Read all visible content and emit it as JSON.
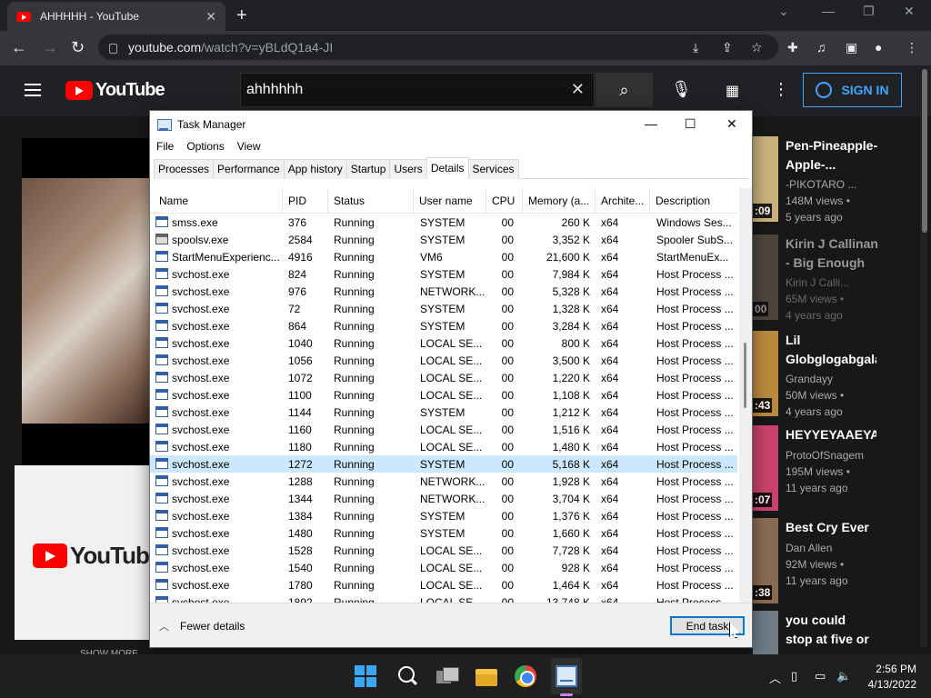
{
  "browser": {
    "tab_title": "AHHHHH - YouTube",
    "url_host": "youtube.com",
    "url_path": "/watch?v=yBLdQ1a4-JI"
  },
  "youtube": {
    "logo_text": "YouTube",
    "search_value": "ahhhhhh",
    "signin_label": "SIGN IN",
    "card_logo_text": "YouTube",
    "show_more": "SHOW MORE",
    "recommendations": [
      {
        "title": "Pen-Pineapple-Apple-...",
        "channel": "-PIKOTARO ...",
        "views": "148M views •",
        "age": "5 years ago",
        "duration": ":09"
      },
      {
        "title": "Kirin J Callinan - Big Enough",
        "channel": "Kirin J Calli...",
        "views": "65M views •",
        "age": "4 years ago",
        "duration": "00"
      },
      {
        "title": "Lil Globglogabgalab",
        "channel": "Grandayy",
        "views": "50M views •",
        "age": "4 years ago",
        "duration": ":43"
      },
      {
        "title": "HEYYEYAAEYAAAEY",
        "channel": "ProtoOfSnagem",
        "views": "195M views •",
        "age": "11 years ago",
        "duration": ":07"
      },
      {
        "title": "Best Cry Ever",
        "channel": "Dan Allen",
        "views": "92M views •",
        "age": "11 years ago",
        "duration": ":38"
      },
      {
        "title": "you could stop at five or six...",
        "channel": "",
        "views": "",
        "age": "",
        "duration": ""
      }
    ]
  },
  "task_manager": {
    "title": "Task Manager",
    "menu": [
      "File",
      "Options",
      "View"
    ],
    "tabs": [
      "Processes",
      "Performance",
      "App history",
      "Startup",
      "Users",
      "Details",
      "Services"
    ],
    "active_tab": "Details",
    "columns": [
      "Name",
      "PID",
      "Status",
      "User name",
      "CPU",
      "Memory (a...",
      "Archite...",
      "Description"
    ],
    "rows": [
      {
        "name": "smss.exe",
        "pid": "376",
        "status": "Running",
        "user": "SYSTEM",
        "cpu": "00",
        "mem": "260 K",
        "arch": "x64",
        "desc": "Windows Ses..."
      },
      {
        "name": "spoolsv.exe",
        "pid": "2584",
        "status": "Running",
        "user": "SYSTEM",
        "cpu": "00",
        "mem": "3,352 K",
        "arch": "x64",
        "desc": "Spooler SubS..."
      },
      {
        "name": "StartMenuExperienc...",
        "pid": "4916",
        "status": "Running",
        "user": "VM6",
        "cpu": "00",
        "mem": "21,600 K",
        "arch": "x64",
        "desc": "StartMenuEx..."
      },
      {
        "name": "svchost.exe",
        "pid": "824",
        "status": "Running",
        "user": "SYSTEM",
        "cpu": "00",
        "mem": "7,984 K",
        "arch": "x64",
        "desc": "Host Process ..."
      },
      {
        "name": "svchost.exe",
        "pid": "976",
        "status": "Running",
        "user": "NETWORK...",
        "cpu": "00",
        "mem": "5,328 K",
        "arch": "x64",
        "desc": "Host Process ..."
      },
      {
        "name": "svchost.exe",
        "pid": "72",
        "status": "Running",
        "user": "SYSTEM",
        "cpu": "00",
        "mem": "1,328 K",
        "arch": "x64",
        "desc": "Host Process ..."
      },
      {
        "name": "svchost.exe",
        "pid": "864",
        "status": "Running",
        "user": "SYSTEM",
        "cpu": "00",
        "mem": "3,284 K",
        "arch": "x64",
        "desc": "Host Process ..."
      },
      {
        "name": "svchost.exe",
        "pid": "1040",
        "status": "Running",
        "user": "LOCAL SE...",
        "cpu": "00",
        "mem": "800 K",
        "arch": "x64",
        "desc": "Host Process ..."
      },
      {
        "name": "svchost.exe",
        "pid": "1056",
        "status": "Running",
        "user": "LOCAL SE...",
        "cpu": "00",
        "mem": "3,500 K",
        "arch": "x64",
        "desc": "Host Process ..."
      },
      {
        "name": "svchost.exe",
        "pid": "1072",
        "status": "Running",
        "user": "LOCAL SE...",
        "cpu": "00",
        "mem": "1,220 K",
        "arch": "x64",
        "desc": "Host Process ..."
      },
      {
        "name": "svchost.exe",
        "pid": "1100",
        "status": "Running",
        "user": "LOCAL SE...",
        "cpu": "00",
        "mem": "1,108 K",
        "arch": "x64",
        "desc": "Host Process ..."
      },
      {
        "name": "svchost.exe",
        "pid": "1144",
        "status": "Running",
        "user": "SYSTEM",
        "cpu": "00",
        "mem": "1,212 K",
        "arch": "x64",
        "desc": "Host Process ..."
      },
      {
        "name": "svchost.exe",
        "pid": "1160",
        "status": "Running",
        "user": "LOCAL SE...",
        "cpu": "00",
        "mem": "1,516 K",
        "arch": "x64",
        "desc": "Host Process ..."
      },
      {
        "name": "svchost.exe",
        "pid": "1180",
        "status": "Running",
        "user": "LOCAL SE...",
        "cpu": "00",
        "mem": "1,480 K",
        "arch": "x64",
        "desc": "Host Process ..."
      },
      {
        "name": "svchost.exe",
        "pid": "1272",
        "status": "Running",
        "user": "SYSTEM",
        "cpu": "00",
        "mem": "5,168 K",
        "arch": "x64",
        "desc": "Host Process ...",
        "selected": true
      },
      {
        "name": "svchost.exe",
        "pid": "1288",
        "status": "Running",
        "user": "NETWORK...",
        "cpu": "00",
        "mem": "1,928 K",
        "arch": "x64",
        "desc": "Host Process ..."
      },
      {
        "name": "svchost.exe",
        "pid": "1344",
        "status": "Running",
        "user": "NETWORK...",
        "cpu": "00",
        "mem": "3,704 K",
        "arch": "x64",
        "desc": "Host Process ..."
      },
      {
        "name": "svchost.exe",
        "pid": "1384",
        "status": "Running",
        "user": "SYSTEM",
        "cpu": "00",
        "mem": "1,376 K",
        "arch": "x64",
        "desc": "Host Process ..."
      },
      {
        "name": "svchost.exe",
        "pid": "1480",
        "status": "Running",
        "user": "SYSTEM",
        "cpu": "00",
        "mem": "1,660 K",
        "arch": "x64",
        "desc": "Host Process ..."
      },
      {
        "name": "svchost.exe",
        "pid": "1528",
        "status": "Running",
        "user": "LOCAL SE...",
        "cpu": "00",
        "mem": "7,728 K",
        "arch": "x64",
        "desc": "Host Process ..."
      },
      {
        "name": "svchost.exe",
        "pid": "1540",
        "status": "Running",
        "user": "LOCAL SE...",
        "cpu": "00",
        "mem": "928 K",
        "arch": "x64",
        "desc": "Host Process ..."
      },
      {
        "name": "svchost.exe",
        "pid": "1780",
        "status": "Running",
        "user": "LOCAL SE...",
        "cpu": "00",
        "mem": "1,464 K",
        "arch": "x64",
        "desc": "Host Process ..."
      },
      {
        "name": "svchost.exe",
        "pid": "1892",
        "status": "Running",
        "user": "LOCAL SE...",
        "cpu": "00",
        "mem": "13,748 K",
        "arch": "x64",
        "desc": "Host Process ..."
      }
    ],
    "fewer_details": "Fewer details",
    "end_task": "End task"
  },
  "taskbar": {
    "time": "2:56 PM",
    "date": "4/13/2022"
  },
  "colors": {
    "chrome_bg": "#202124",
    "youtube_red": "#ff0000",
    "signin_blue": "#3ea6ff",
    "selected_row": "#cce8ff",
    "focus_blue": "#0078d7"
  }
}
